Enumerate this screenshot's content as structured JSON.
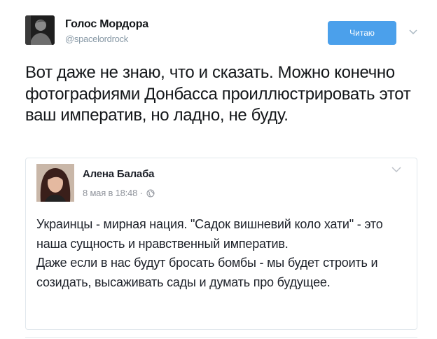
{
  "author": {
    "name": "Голос Мордора",
    "handle": "@spacelordrock",
    "avatar_icon": "user-avatar-photo"
  },
  "follow_button": {
    "label": "Читаю",
    "color": "#4ba0eb"
  },
  "menu_icon": "chevron-down-icon",
  "tweet": {
    "text": "Вот даже не знаю, что и сказать. Можно конечно фотографиями Донбасса проиллюстрировать этот ваш императив, но ладно, не буду."
  },
  "embedded_post": {
    "author_name": "Алена Балаба",
    "date": "8 мая в 18:48",
    "separator": "·",
    "privacy_icon": "globe-icon",
    "text": "Украинцы - мирная нация. \"Садок вишневий коло хати\" - это наша сущность и нравственный императив.\nДаже если в нас будут бросать бомбы - мы будет строить и созидать, высаживать сады и думать про будущее."
  }
}
